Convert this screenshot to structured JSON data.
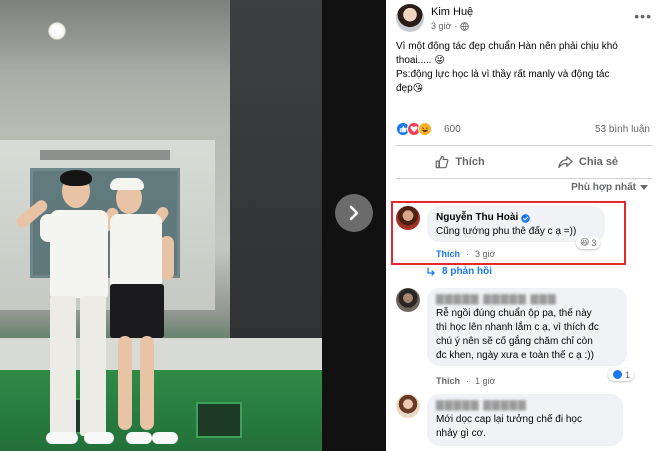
{
  "post": {
    "author": "Kim Huệ",
    "time": "3 giờ",
    "privacy_icon": "globe-icon",
    "caption_line1": "Vì một động tác đẹp chuẩn Hàn nên phải chịu khó thoai.....",
    "caption_emoji1": "😜",
    "caption_line2": "Ps:động lực học là vì thầy rất manly và động tác đẹp",
    "caption_emoji2": "😘"
  },
  "reactions": {
    "count": "600",
    "comment_count": "53 bình luận",
    "icons": [
      "like-icon",
      "love-icon",
      "haha-icon"
    ]
  },
  "actions": {
    "like_label": "Thích",
    "share_label": "Chia sẻ"
  },
  "sort": {
    "label": "Phù hợp nhất"
  },
  "comments": [
    {
      "name": "Nguyễn Thu Hoài",
      "verified": true,
      "text": "Cũng tướng phu thê đấy c ạ =))",
      "like_label": "Thích",
      "time": "3 giờ",
      "reaction_count": "3",
      "reaction_emoji": "😆",
      "replies_label": "8 phản hồi"
    },
    {
      "name": "",
      "text_line1": "Rễ ngồi đúng chuẩn ộp pa, thế này",
      "text_line2": "thì học lên nhanh lắm c ạ, vì thích đc",
      "text_line3": "chú ý nên sẽ cố gắng chăm chỉ còn",
      "text_line4": "đc khen, ngày xưa e toàn thế c ạ :))",
      "like_label": "Thích",
      "time": "1 giờ",
      "reaction_count": "1"
    },
    {
      "name": "",
      "text_line1": "Mới dọc cap lại tưởng chế đi học",
      "text_line2": "nhảy gì cơ."
    }
  ],
  "colors": {
    "facebook_blue": "#1877f2",
    "highlight_red": "#e8262d",
    "secondary_text": "#65676b"
  }
}
